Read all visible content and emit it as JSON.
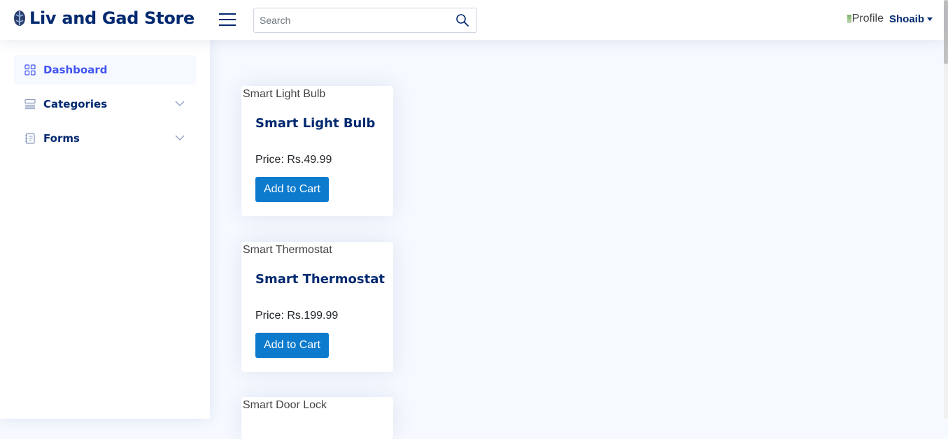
{
  "header": {
    "brand_name": "Liv and Gad Store",
    "search_placeholder": "Search",
    "profile_img_alt": "Profile",
    "profile_name": "Shoaib"
  },
  "sidebar": {
    "items": [
      {
        "label": "Dashboard",
        "icon": "grid-icon",
        "active": true
      },
      {
        "label": "Categories",
        "icon": "menu-button-icon",
        "expandable": true
      },
      {
        "label": "Forms",
        "icon": "journal-text-icon",
        "expandable": true
      }
    ]
  },
  "products": [
    {
      "img_alt": "Smart Light Bulb",
      "name": "Smart Light Bulb",
      "price": "Price: Rs.49.99",
      "button": "Add to Cart"
    },
    {
      "img_alt": "Smart Thermostat",
      "name": "Smart Thermostat",
      "price": "Price: Rs.199.99",
      "button": "Add to Cart"
    },
    {
      "img_alt": "Smart Door Lock"
    }
  ],
  "colors": {
    "primary_text": "#012970",
    "active_link": "#4154f1",
    "button": "#0d7bcd",
    "page_bg": "#f6f9ff"
  }
}
